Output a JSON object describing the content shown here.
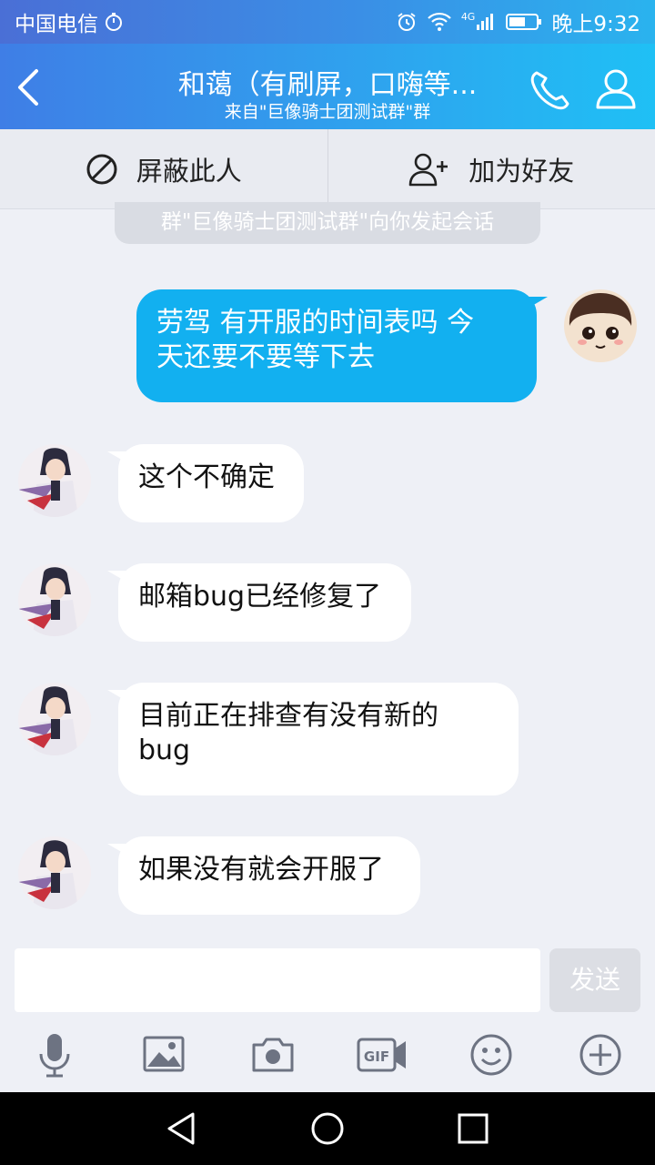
{
  "status_bar": {
    "carrier": "中国电信",
    "network": "4G",
    "time": "晚上9:32"
  },
  "title_bar": {
    "title": "和蔼（有刷屏，口嗨等...",
    "subtitle": "来自\"巨像骑士团测试群\"群"
  },
  "actions": {
    "block_label": "屏蔽此人",
    "add_friend_label": "加为好友"
  },
  "system_message": "群\"巨像骑士团测试群\"向你发起会话",
  "messages": [
    {
      "sender": "me",
      "text_line1": "劳驾 有开服的时间表吗 今",
      "text_line2": "天还要不要等下去"
    },
    {
      "sender": "them",
      "text": "这个不确定"
    },
    {
      "sender": "them",
      "text": "邮箱bug已经修复了"
    },
    {
      "sender": "them",
      "text_line1": "目前正在排查有没有新的",
      "text_line2": "bug"
    },
    {
      "sender": "them",
      "text": "如果没有就会开服了"
    }
  ],
  "input": {
    "value": "",
    "send_label": "发送"
  },
  "toolbar_icons": [
    "microphone-icon",
    "image-icon",
    "camera-icon",
    "gif-icon",
    "emoji-icon",
    "plus-icon"
  ],
  "colors": {
    "my_bubble": "#12b0f0",
    "their_bubble": "#ffffff",
    "background": "#eef0f6",
    "header": "#2fa2ee"
  }
}
